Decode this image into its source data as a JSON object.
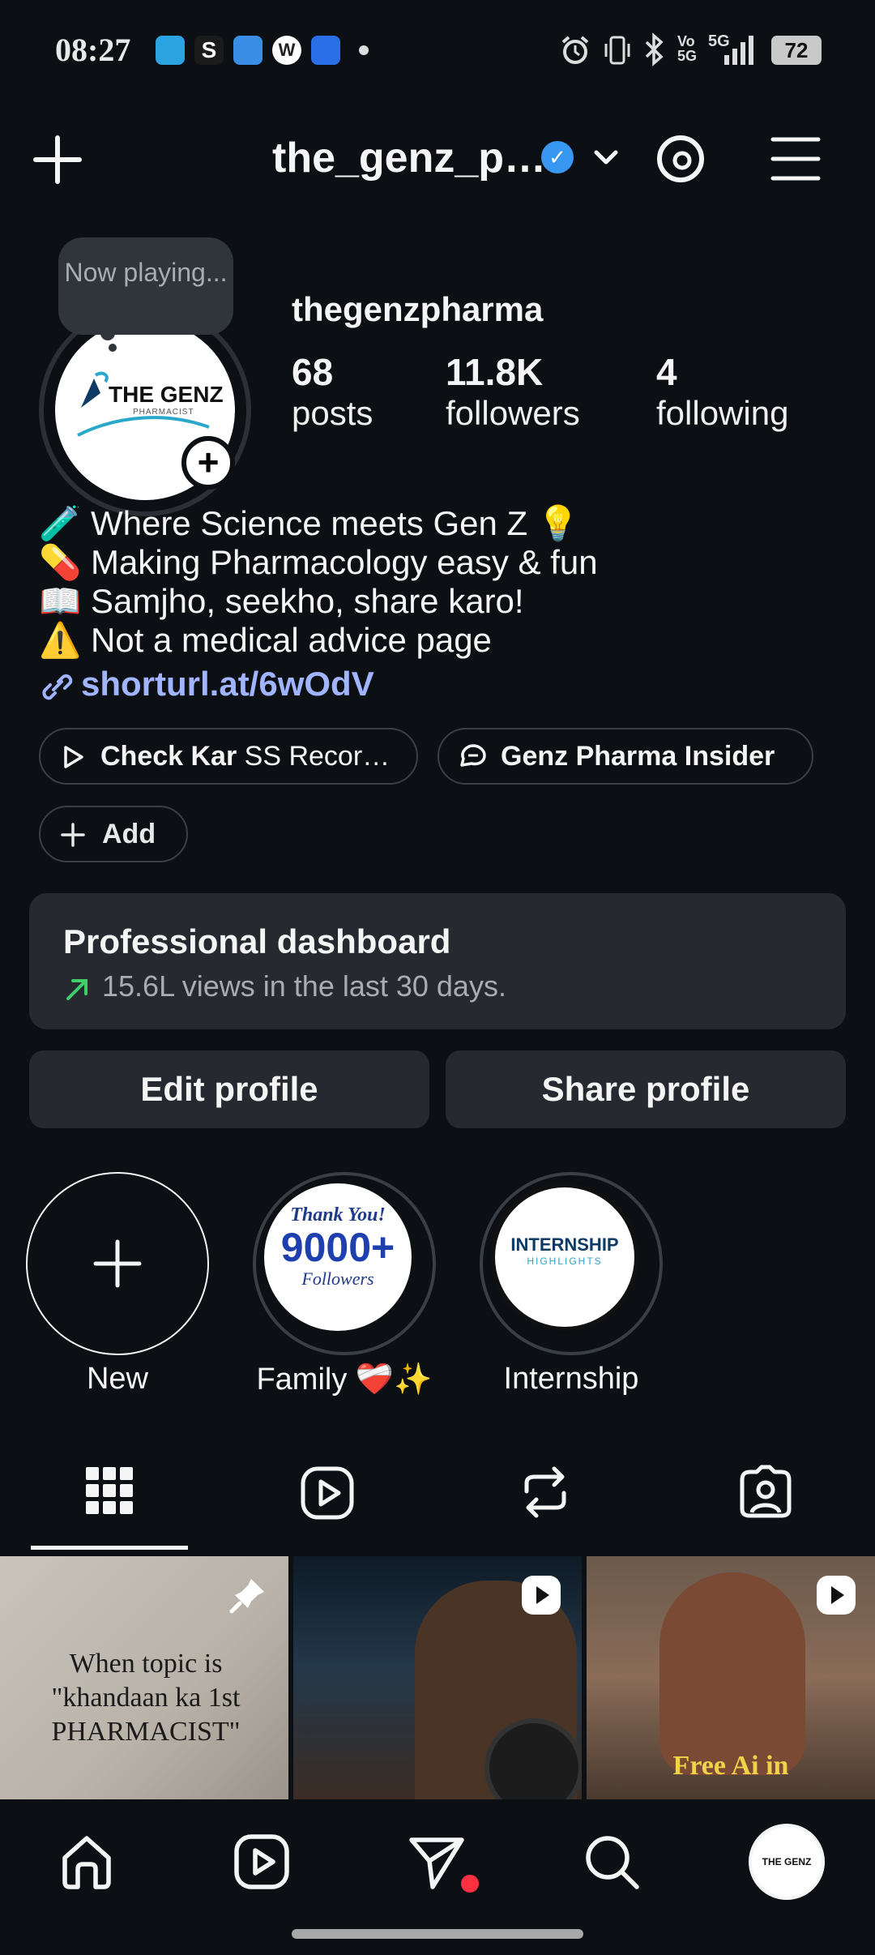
{
  "status_bar": {
    "time": "08:27",
    "battery": "72",
    "network": "5G"
  },
  "header": {
    "account_name": "the_genz_p…",
    "verified": true
  },
  "profile": {
    "now_playing": "Now playing...",
    "username": "thegenzpharma",
    "avatar_text": "THE GENZ",
    "avatar_subtext": "PHARMACIST",
    "stats": [
      {
        "value": "68",
        "label": "posts"
      },
      {
        "value": "11.8K",
        "label": "followers"
      },
      {
        "value": "4",
        "label": "following"
      }
    ],
    "bio": [
      "🧪 Where Science meets Gen Z 💡",
      "💊 Making Pharmacology easy & fun",
      "📖 Samjho, seekho, share karo!",
      "⚠️ Not a medical advice page"
    ],
    "link": "shorturl.at/6wOdV"
  },
  "pills": {
    "first_bold": "Check Kar",
    "first_rest": " SS Recor…",
    "second": "Genz Pharma Insider",
    "add": "Add"
  },
  "dashboard": {
    "title": "Professional dashboard",
    "subtitle": "15.6L views in the last 30 days."
  },
  "buttons": {
    "edit": "Edit profile",
    "share": "Share profile"
  },
  "highlights": [
    {
      "label": "New"
    },
    {
      "label": "Family ❤️‍🩹✨",
      "cover_title": "Thank You!",
      "cover_big": "9000+",
      "cover_sub": "Followers"
    },
    {
      "label": "Internship",
      "cover_title": "INTERNSHIP",
      "cover_sub": "HIGHLIGHTS"
    }
  ],
  "grid": [
    {
      "caption": "When topic is \"khandaan ka 1st PHARMACIST\"",
      "pinned": true
    },
    {
      "caption": "",
      "reel": true
    },
    {
      "caption": "Free Ai in",
      "reel": true
    }
  ],
  "colors": {
    "background": "#0c1014",
    "surface": "#262a30",
    "link": "#a0b4ff",
    "verified": "#3897f0",
    "notification_dot": "#ff3040"
  }
}
